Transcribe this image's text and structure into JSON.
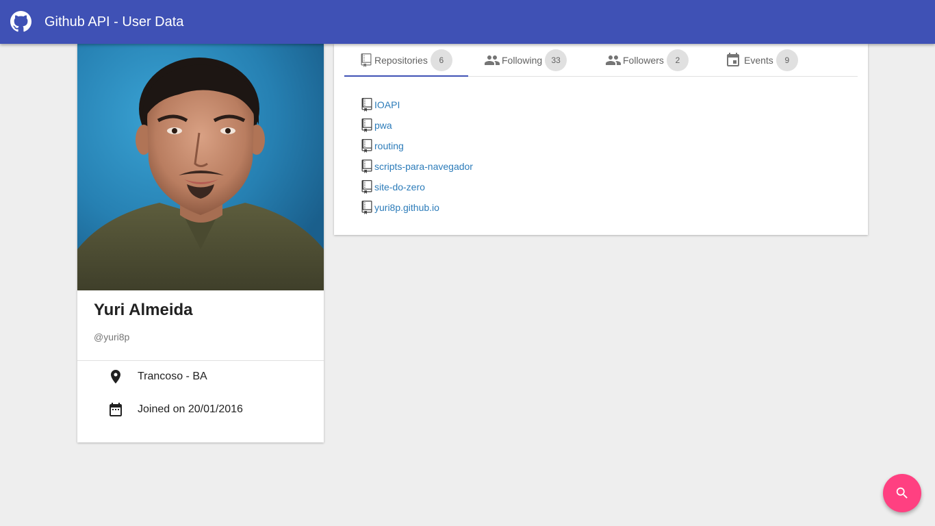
{
  "app": {
    "title": "Github API - User Data"
  },
  "profile": {
    "name": "Yuri Almeida",
    "login": "@yuri8p",
    "location": "Trancoso - BA",
    "joined": "Joined on 20/01/2016"
  },
  "tabs": [
    {
      "label": "Repositories",
      "count": "6",
      "icon": "repo-icon",
      "active": true
    },
    {
      "label": "Following",
      "count": "33",
      "icon": "people-icon",
      "active": false
    },
    {
      "label": "Followers",
      "count": "2",
      "icon": "people-icon",
      "active": false
    },
    {
      "label": "Events",
      "count": "9",
      "icon": "event-icon",
      "active": false
    }
  ],
  "repositories": [
    {
      "name": "IOAPI"
    },
    {
      "name": "pwa"
    },
    {
      "name": "routing"
    },
    {
      "name": "scripts-para-navegador"
    },
    {
      "name": "site-do-zero"
    },
    {
      "name": "yuri8p.github.io"
    }
  ],
  "colors": {
    "primary": "#3f51b5",
    "accent": "#ff4081",
    "link": "#2b7bb9",
    "background": "#eeeeee"
  },
  "icons": {
    "logo": "github-icon",
    "location": "place-icon",
    "joined": "calendar-icon",
    "fab": "search-icon"
  }
}
